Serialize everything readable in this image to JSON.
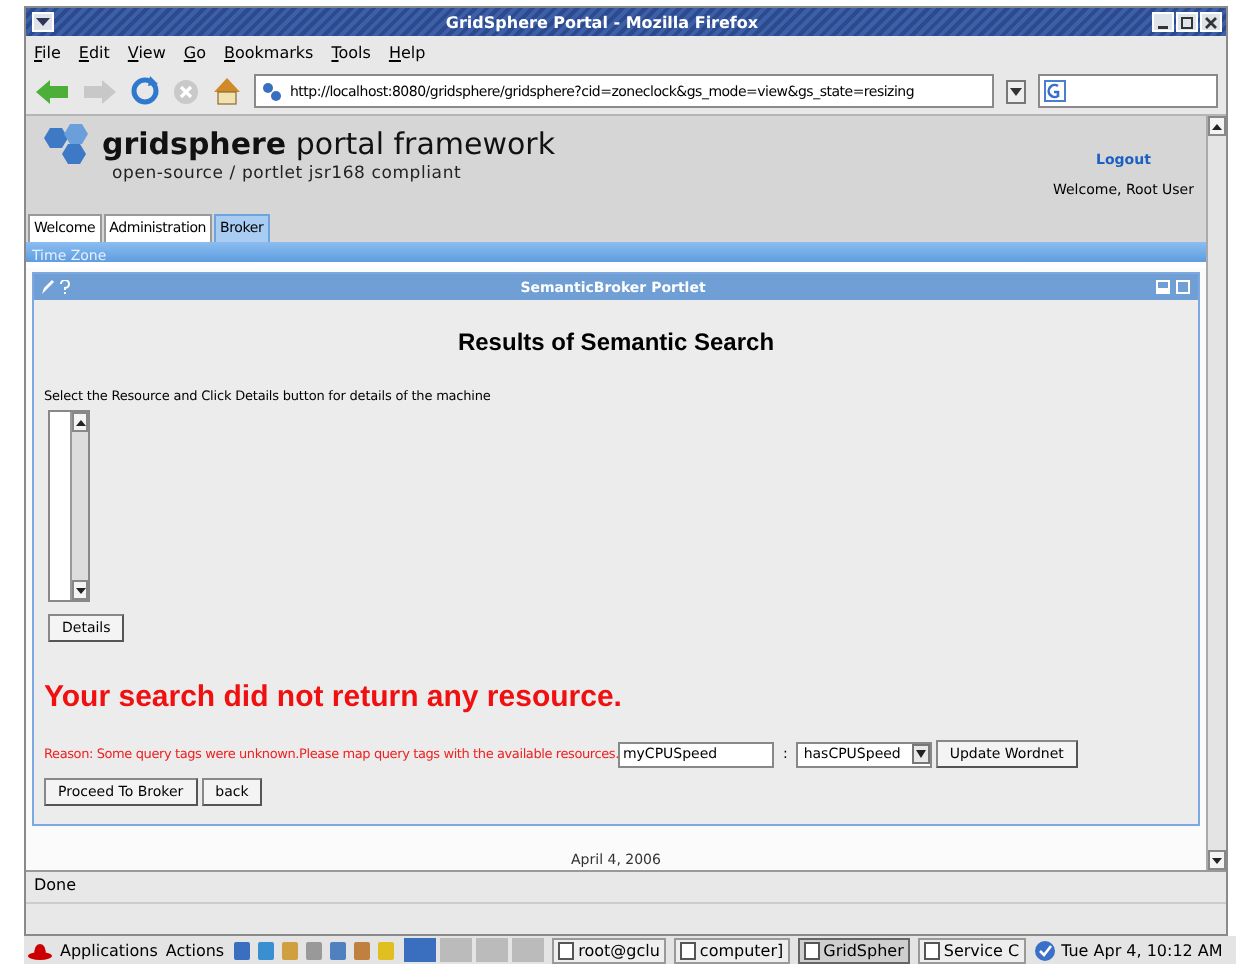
{
  "window": {
    "title": "GridSphere Portal - Mozilla Firefox"
  },
  "menu": [
    "File",
    "Edit",
    "View",
    "Go",
    "Bookmarks",
    "Tools",
    "Help"
  ],
  "address": {
    "value": "http://localhost:8080/gridsphere/gridsphere?cid=zoneclock&gs_mode=view&gs_state=resizing"
  },
  "header": {
    "brand_bold": "gridsphere",
    "brand_light": "portal framework",
    "tagline": "open-source / portlet jsr168 compliant",
    "logout": "Logout",
    "welcome": "Welcome, Root User"
  },
  "tabs": [
    {
      "label": "Welcome",
      "selected": false
    },
    {
      "label": "Administration",
      "selected": false
    },
    {
      "label": "Broker",
      "selected": true
    }
  ],
  "subnav": "Time Zone",
  "portlet": {
    "title": "SemanticBroker Portlet",
    "heading": "Results of Semantic Search",
    "instruction": "Select the Resource and Click Details button for details of the machine",
    "details_button": "Details",
    "error": "Your search did not return any resource.",
    "reason": "Reason: Some query tags were unknown.Please map query tags with the available resources.",
    "tag_value": "myCPUSpeed",
    "separator": ":",
    "mapping_value": "hasCPUSpeed",
    "update_button": "Update Wordnet",
    "buttons": [
      "Proceed To Broker",
      "back"
    ]
  },
  "footer": "April 4, 2006",
  "status": "Done",
  "taskbar": {
    "menus": [
      "Applications",
      "Actions"
    ],
    "windows": [
      {
        "label": "root@gclu",
        "selected": false
      },
      {
        "label": "computer]",
        "selected": false
      },
      {
        "label": "GridSpher",
        "selected": true
      },
      {
        "label": "Service C",
        "selected": false
      }
    ],
    "clock": "Tue Apr  4, 10:12 AM"
  }
}
